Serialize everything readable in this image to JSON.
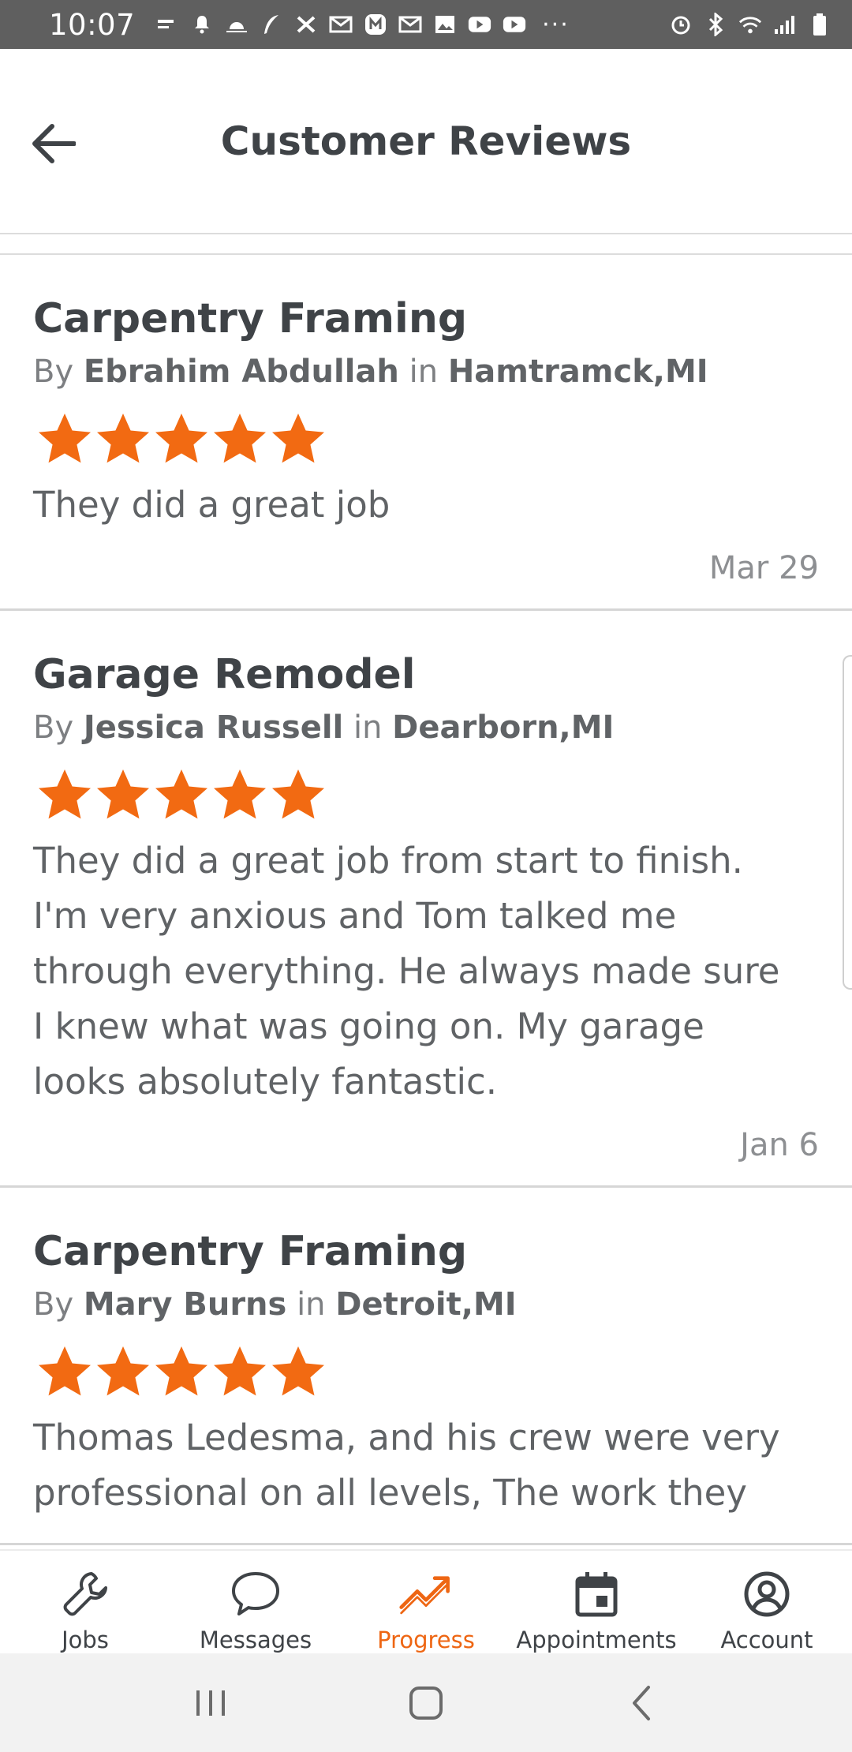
{
  "status_bar": {
    "time": "10:07",
    "more": "···"
  },
  "header": {
    "title": "Customer Reviews"
  },
  "reviews": [
    {
      "title": "Carpentry Framing",
      "by_prefix": "By",
      "author": "Ebrahim Abdullah",
      "in_word": "in",
      "location": "Hamtramck,MI",
      "rating": 5,
      "text": "They did a great job",
      "date": "Mar 29"
    },
    {
      "title": "Garage Remodel",
      "by_prefix": "By",
      "author": "Jessica Russell",
      "in_word": "in",
      "location": "Dearborn,MI",
      "rating": 5,
      "text": "They did a great job from start to finish. I'm very anxious and Tom talked me through everything. He always made sure I knew what was going on. My garage looks absolutely fantastic.",
      "date": "Jan 6"
    },
    {
      "title": "Carpentry Framing",
      "by_prefix": "By",
      "author": "Mary Burns",
      "in_word": "in",
      "location": "Detroit,MI",
      "rating": 5,
      "text": "Thomas Ledesma, and his crew were very professional on all levels, The work they",
      "date": ""
    }
  ],
  "bottom_nav": {
    "items": [
      {
        "label": "Jobs",
        "icon": "wrench-icon"
      },
      {
        "label": "Messages",
        "icon": "chat-bubble-icon"
      },
      {
        "label": "Progress",
        "icon": "trending-up-icon"
      },
      {
        "label": "Appointments",
        "icon": "calendar-icon"
      },
      {
        "label": "Account",
        "icon": "account-circle-icon"
      }
    ],
    "active_index": 2
  },
  "colors": {
    "accent": "#ee6613",
    "star": "#f26a12",
    "status_bar": "#5f5f5f"
  }
}
